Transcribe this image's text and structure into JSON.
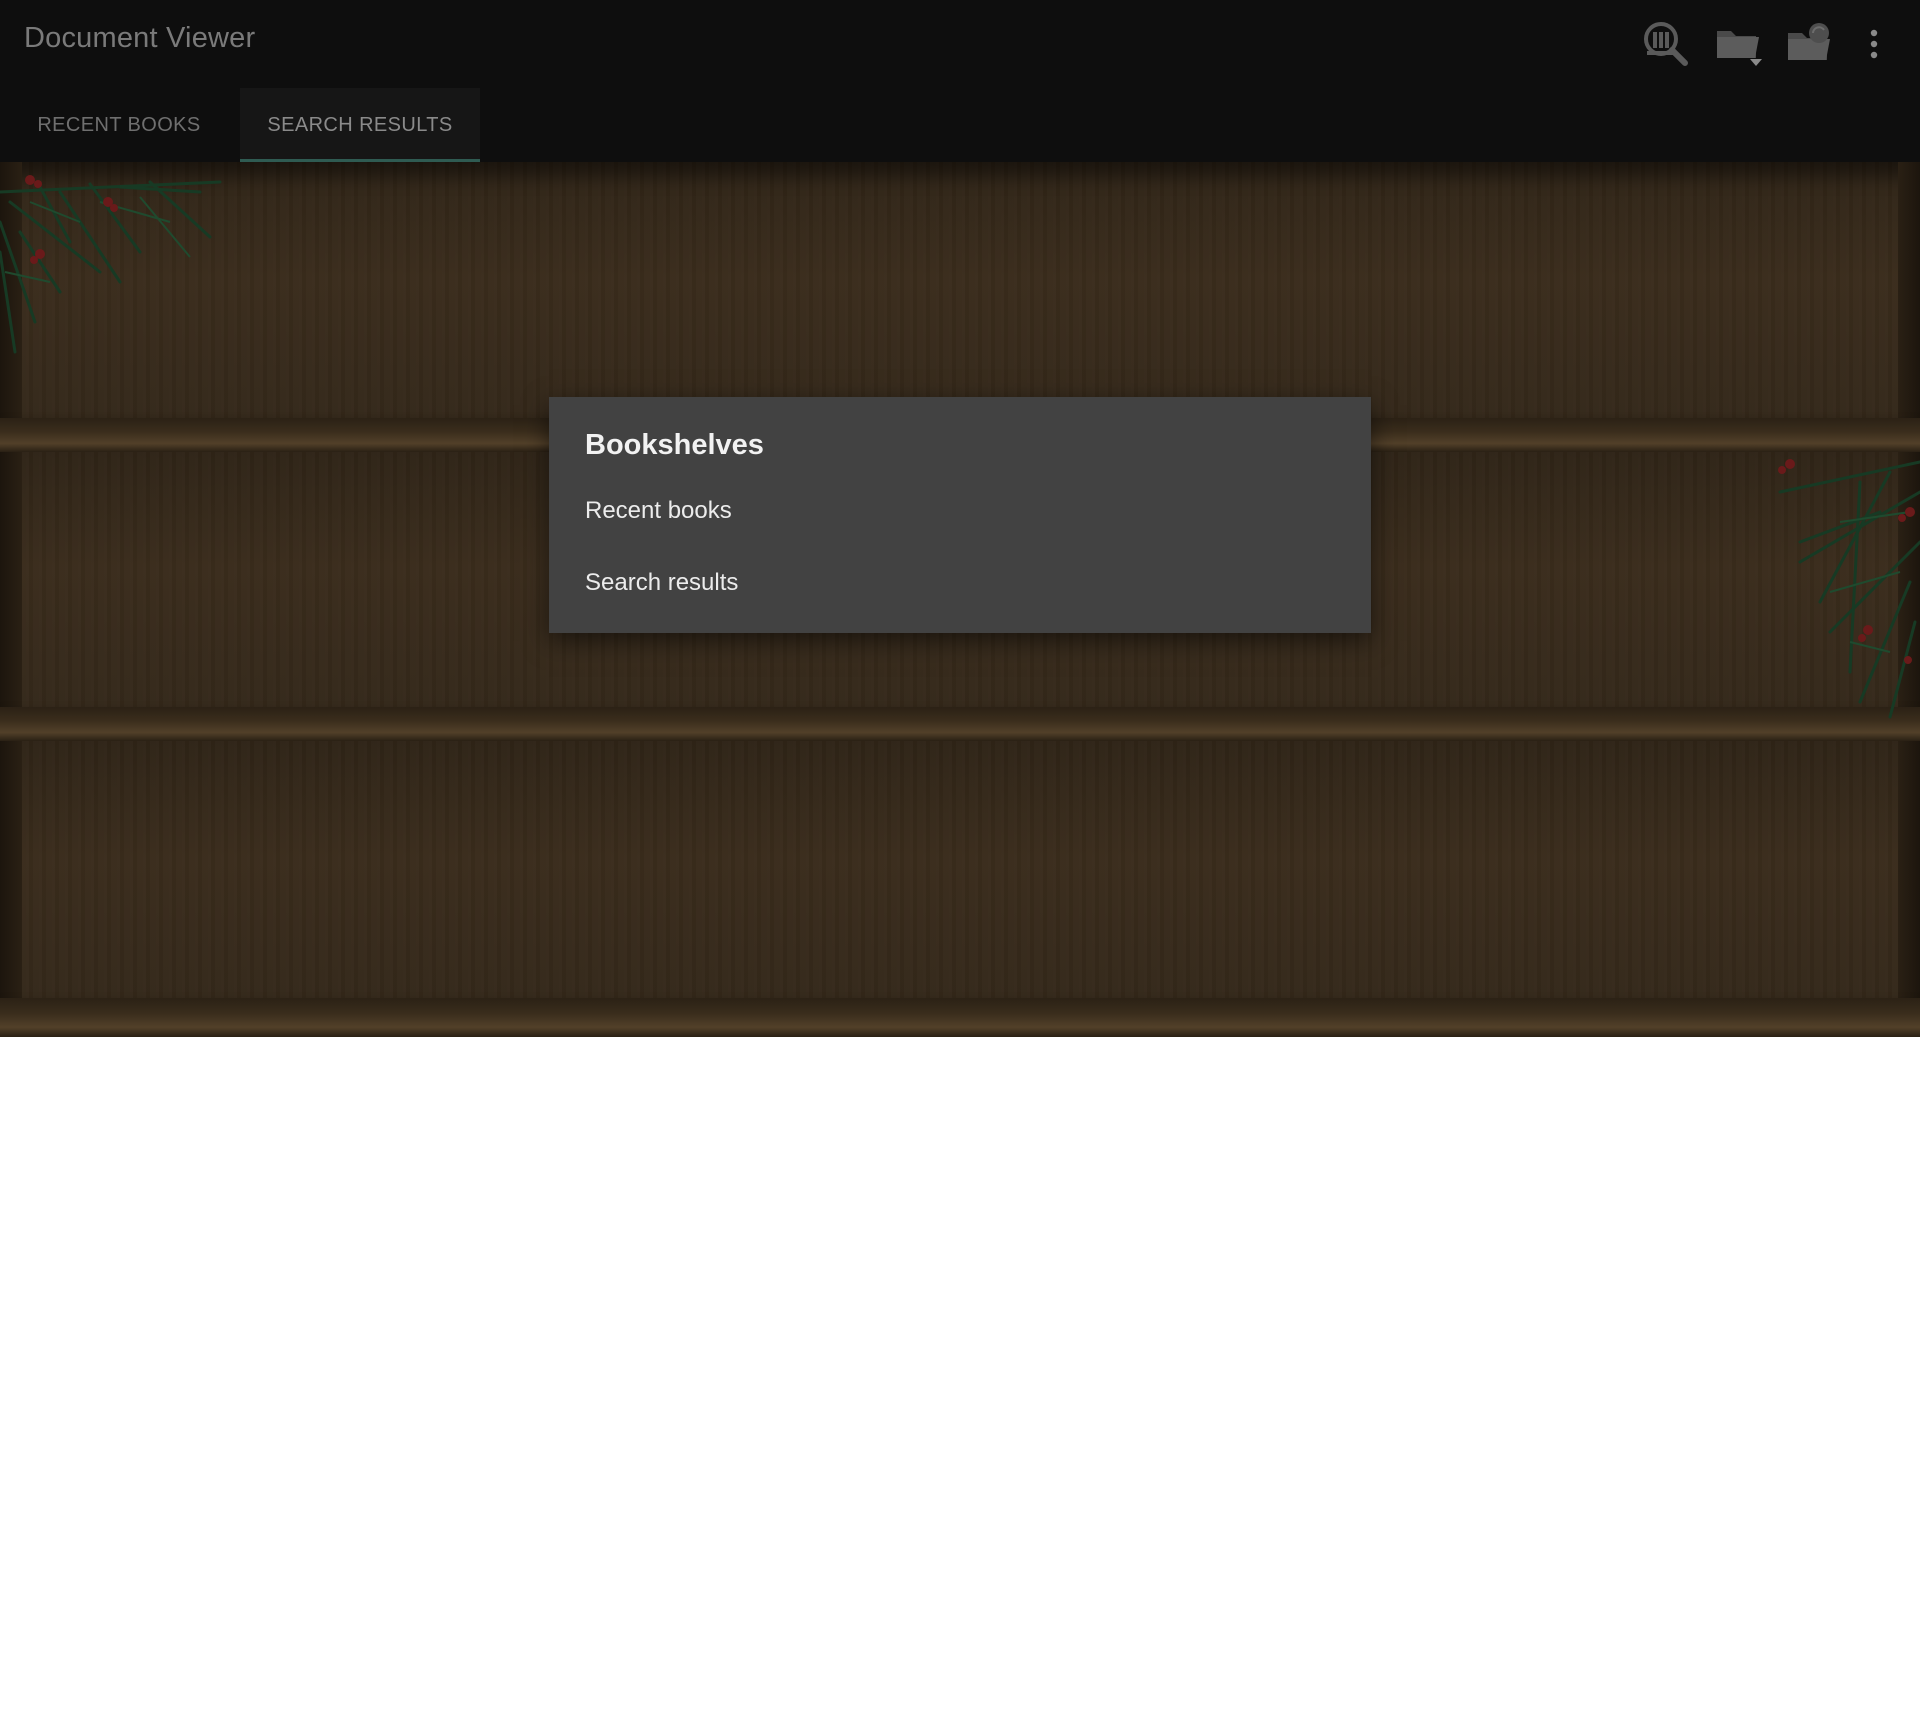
{
  "app": {
    "title": "Document Viewer"
  },
  "toolbar": {
    "actions": [
      {
        "icon": "library-search-icon"
      },
      {
        "icon": "folder-dropdown-icon"
      },
      {
        "icon": "folder-sync-icon"
      },
      {
        "icon": "more-vert-icon"
      }
    ]
  },
  "tabs": [
    {
      "label": "RECENT BOOKS",
      "selected": false
    },
    {
      "label": "SEARCH RESULTS",
      "selected": true
    }
  ],
  "dialog": {
    "title": "Bookshelves",
    "items": [
      {
        "label": "Recent books"
      },
      {
        "label": "Search results"
      }
    ]
  },
  "colors": {
    "appbar_bg": "#0e0e0e",
    "dialog_bg": "#424242",
    "tab_indicator": "#2f5b52",
    "shelf_wood": "#3a2c1c"
  }
}
